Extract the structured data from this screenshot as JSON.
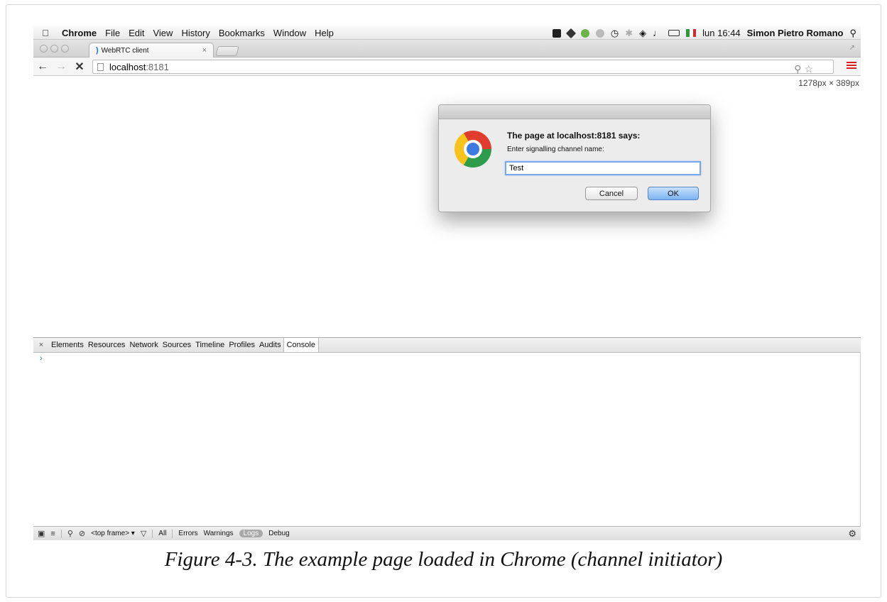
{
  "menubar": {
    "app": "Chrome",
    "items": [
      "File",
      "Edit",
      "View",
      "History",
      "Bookmarks",
      "Window",
      "Help"
    ],
    "clock": "lun 16:44",
    "user": "Simon Pietro Romano",
    "status_icons": [
      "dropbox-icon",
      "drive-icon",
      "sync-icon",
      "camera-icon",
      "time-machine-icon",
      "bluetooth-icon",
      "wifi-icon",
      "volume-icon",
      "battery-icon",
      "italian-flag-icon"
    ]
  },
  "tab": {
    "title": "WebRTC client",
    "close": "×"
  },
  "toolbar": {
    "back": "←",
    "forward": "→",
    "stop": "✕",
    "url_host": "localhost",
    "url_port": ":8181"
  },
  "viewport": {
    "dimensions": "1278px × 389px"
  },
  "dialog": {
    "heading": "The page at localhost:8181 says:",
    "message": "Enter signalling channel name:",
    "input_value": "Test",
    "cancel": "Cancel",
    "ok": "OK"
  },
  "devtools": {
    "close": "×",
    "tabs": [
      "Elements",
      "Resources",
      "Network",
      "Sources",
      "Timeline",
      "Profiles",
      "Audits",
      "Console"
    ],
    "active_tab": "Console",
    "prompt": "›",
    "frame_select": "<top frame> ▾",
    "levels": {
      "all": "All",
      "errors": "Errors",
      "warnings": "Warnings",
      "logs": "Logs",
      "debug": "Debug"
    }
  },
  "caption": "Figure 4-3. The example page loaded in Chrome (channel initiator)",
  "colors": {
    "menu_icon_red": "#d91e1e",
    "console_prompt_blue": "#2f6de0"
  }
}
